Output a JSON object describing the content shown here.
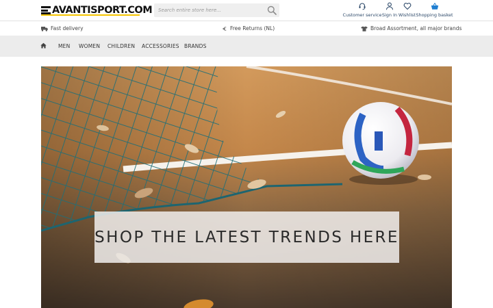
{
  "logo": {
    "text": "AVANTISPORT.COM",
    "accent_color": "#f5c400"
  },
  "search": {
    "placeholder": "Search entire store here...",
    "icon": "magnifier-icon"
  },
  "header_links": [
    {
      "label": "Customer service",
      "icon": "headset-icon"
    },
    {
      "label": "Sign In",
      "icon": "user-icon"
    },
    {
      "label": "Wishlist",
      "icon": "heart-icon"
    },
    {
      "label": "Shopping basket",
      "icon": "basket-icon",
      "icon_color": "#1f7fd1"
    }
  ],
  "usp": [
    {
      "label": "Fast delivery",
      "icon": "truck-icon"
    },
    {
      "label": "Free Returns (NL)",
      "icon": "euro-icon"
    },
    {
      "label": "Broad Assortment, all major brands",
      "icon": "shirt-icon"
    }
  ],
  "nav": {
    "home_icon": "home-icon",
    "items": [
      "MEN",
      "WOMEN",
      "CHILDREN",
      "ACCESSORIES",
      "BRANDS"
    ]
  },
  "hero": {
    "banner_text": "SHOP THE LATEST TRENDS HERE"
  }
}
